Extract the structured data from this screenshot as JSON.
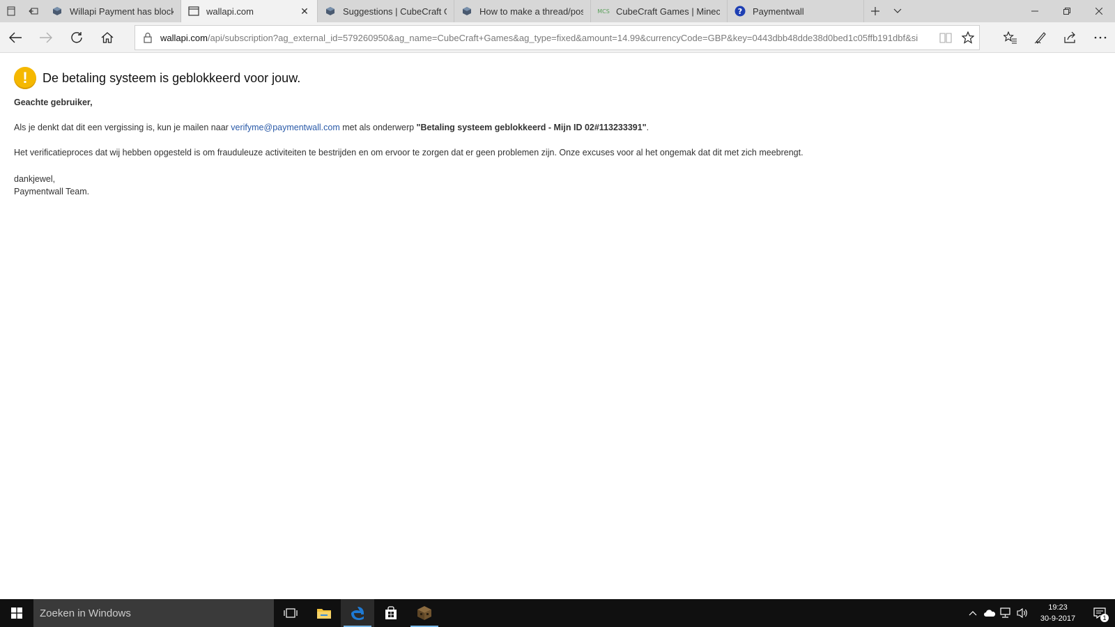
{
  "tabs": [
    {
      "title": "Willapi Payment has blocked",
      "icon": "cube-icon",
      "active": false
    },
    {
      "title": "wallapi.com",
      "icon": "page-icon",
      "active": true
    },
    {
      "title": "Suggestions | CubeCraft Ga",
      "icon": "cube-icon",
      "active": false
    },
    {
      "title": "How to make a thread/post",
      "icon": "cube-icon",
      "active": false
    },
    {
      "title": "CubeCraft Games | Minecra",
      "icon": "mcs-icon",
      "active": false
    },
    {
      "title": "Paymentwall",
      "icon": "help-icon",
      "active": false
    }
  ],
  "mcs_text": "MCS",
  "address": {
    "host": "wallapi.com",
    "path": "/api/subscription?ag_external_id=579260950&ag_name=CubeCraft+Games&ag_type=fixed&amount=14.99&currencyCode=GBP&key=0443dbb48dde38d0bed1c05ffb191dbf&si"
  },
  "page": {
    "heading": "De betaling systeem is geblokkeerd voor jouw.",
    "greeting": "Geachte gebruiker,",
    "para1_pre": "Als je denkt dat dit een vergissing is, kun je mailen naar ",
    "para1_email": "verifyme@paymentwall.com",
    "para1_mid": " met als onderwerp ",
    "para1_subject": "\"Betaling systeem geblokkeerd - Mijn ID 02#113233391\"",
    "para1_end": ".",
    "para2": "Het verificatieproces dat wij hebben opgesteld is om frauduleuze activiteiten te bestrijden en om ervoor te zorgen dat er geen problemen zijn. Onze excuses voor al het ongemak dat dit met zich meebrengt.",
    "sign1": "dankjewel,",
    "sign2": "Paymentwall Team."
  },
  "taskbar": {
    "search_placeholder": "Zoeken in Windows",
    "time": "19:23",
    "date": "30-9-2017",
    "notification_count": "1"
  },
  "colors": {
    "warning": "#f5b800",
    "link": "#2a5aa8",
    "taskbar": "#101010",
    "edge_blue": "#1e7ad4"
  }
}
